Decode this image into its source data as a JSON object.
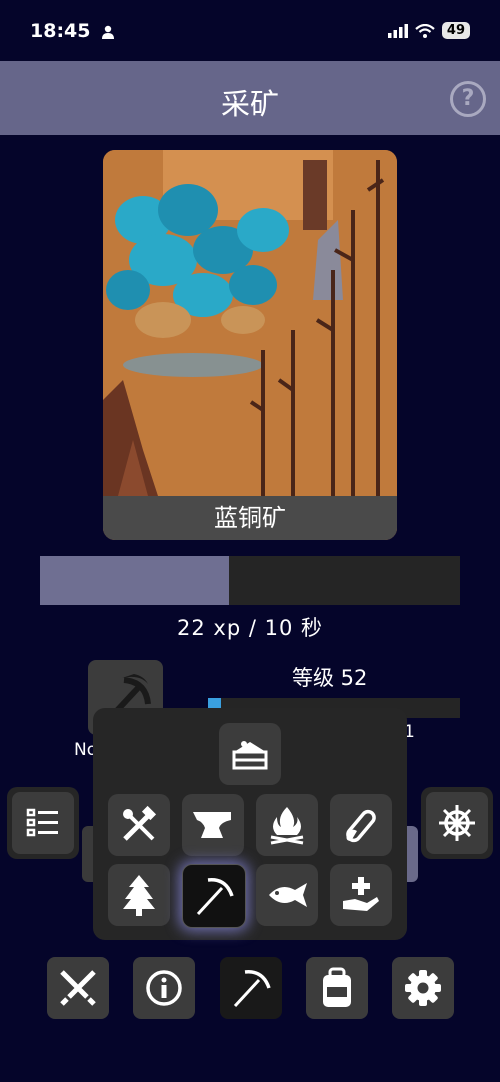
{
  "status_bar": {
    "time": "18:45",
    "battery": "49"
  },
  "header": {
    "title": "采矿",
    "help_symbol": "?"
  },
  "ore": {
    "name": "蓝铜矿"
  },
  "progress": {
    "fraction": 0.45
  },
  "xp": {
    "text": "22 xp / 10 秒"
  },
  "level": {
    "text": "等级 52",
    "fraction": 0.05
  },
  "partial_text": {
    "left": "No",
    "right": "1"
  },
  "popup": {
    "top_icon": "cake-icon",
    "skills": [
      "tools-icon",
      "anvil-icon",
      "campfire-icon",
      "potion-icon",
      "tree-icon",
      "pickaxe-icon",
      "fish-icon",
      "hand-plus-icon"
    ],
    "active_skill": "pickaxe-icon"
  },
  "side_buttons": {
    "left": "list-icon",
    "right": "ship-wheel-icon"
  },
  "bottom_nav": [
    "swords-icon",
    "info-icon",
    "pickaxe-icon",
    "backpack-icon",
    "gear-icon"
  ],
  "colors": {
    "background": "#05052a",
    "header": "#66668a",
    "progress": "#6f6f92",
    "level": "#3aa0e0"
  }
}
